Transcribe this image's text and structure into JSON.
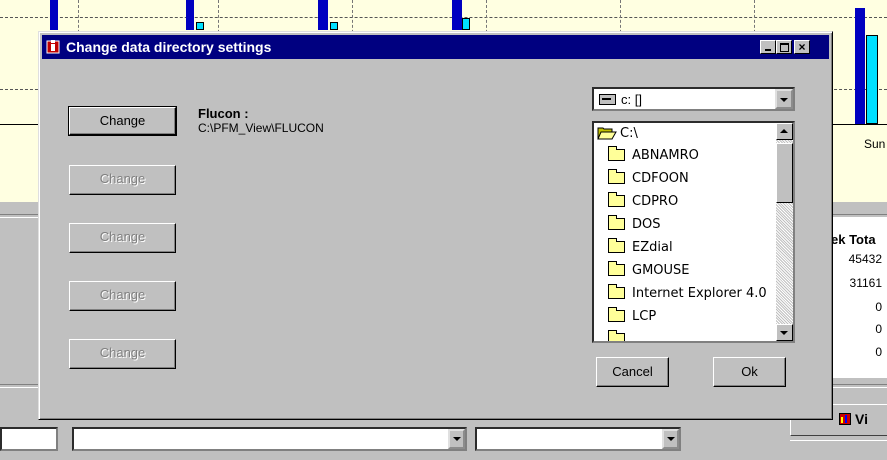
{
  "background": {
    "chart_day_label": "Sun",
    "table_header": "ek Tota",
    "table_values": [
      "45432",
      "31161",
      "0",
      "0",
      "0"
    ],
    "view_button_label": "Vi"
  },
  "dialog": {
    "title": "Change data directory settings",
    "title_buttons": {
      "minimize": "_",
      "maximize": "□",
      "close": "×"
    },
    "change_buttons": [
      "Change",
      "Change",
      "Change",
      "Change",
      "Change"
    ],
    "directory_label": "Flucon :",
    "directory_path": "C:\\PFM_View\\FLUCON",
    "drive": "c: []",
    "folders": [
      "C:\\",
      "ABNAMRO",
      "CDFOON",
      "CDPRO",
      "DOS",
      "EZdial",
      "GMOUSE",
      "Internet Explorer 4.0",
      "LCP"
    ],
    "cancel_label": "Cancel",
    "ok_label": "Ok"
  }
}
